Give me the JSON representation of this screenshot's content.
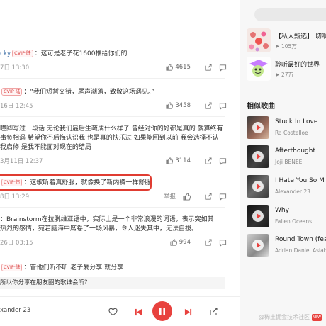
{
  "comments": [
    {
      "user": "cky",
      "vip": "CVIP·陆",
      "text": "：这可是老子花1600推给你们的",
      "time": "7日 13:30",
      "likes": "4615"
    },
    {
      "user": "",
      "vip": "CVIP·陆",
      "text": "：“我们短暂交错，尾声潮落，致敬这场遇见。”",
      "time": "16日 12:45",
      "likes": "3458"
    },
    {
      "user": "",
      "vip": "",
      "lines": [
        "瞳卿写过一段话 无论我们最后生疏成什么样子 曾经对你的好都是真的 就算终有",
        "事负相遇 希望你不后悔认识我 也是真的快乐过 如果能回到以前 我会选择不认",
        "我启修 是我不能面对现在的结局"
      ],
      "time": "3月11日 12:37",
      "likes": "3114"
    },
    {
      "user": "",
      "vip": "CVIP·伍",
      "text": "：这歌听着真舒服，就像换了新内裤一样舒服",
      "time": "8日 13:29",
      "report": "举报"
    },
    {
      "user": "",
      "vip": "",
      "lines": [
        "：Brainstorm在拉脱维亚语中，实际上是一个非常浪漫的词语，表示突如其",
        "热烈的感情，宛若脑海中席卷了一场风暴，令人迷失其中，无法自拔。"
      ],
      "time": "26日 03:15",
      "likes": "994"
    },
    {
      "user": "",
      "vip": "CVIP·陆",
      "text": "：管他们听不听 老子爱分享 就分享",
      "time": "",
      "likes": ""
    }
  ],
  "reply_prompt": "所以你分享在朋友圈的歌谁会听?",
  "player": {
    "artist": "xander 23"
  },
  "sidebar": {
    "playlists": [
      {
        "title": "【私人甄选】 切啊",
        "count": "105万"
      },
      {
        "title": "聆听最好的世界",
        "count": "27万"
      }
    ],
    "similar_title": "相似歌曲",
    "songs": [
      {
        "name": "Stuck In Love",
        "artist": "Ra Costelloe"
      },
      {
        "name": "Afterthought",
        "artist": "Joji BENEE"
      },
      {
        "name": "I Hate You So M",
        "artist": "Alexander 23"
      },
      {
        "name": "Why",
        "artist": "Fallen Oceans"
      },
      {
        "name": "Round Town (fea",
        "artist": "Adrian Daniel Asiah"
      }
    ]
  },
  "watermark": "@稀土掘金技术社区",
  "watermark_badge": "NEW",
  "colors": {
    "accent": "#e8423e",
    "highlight": "#e03c31",
    "user_link": "#507daf"
  }
}
